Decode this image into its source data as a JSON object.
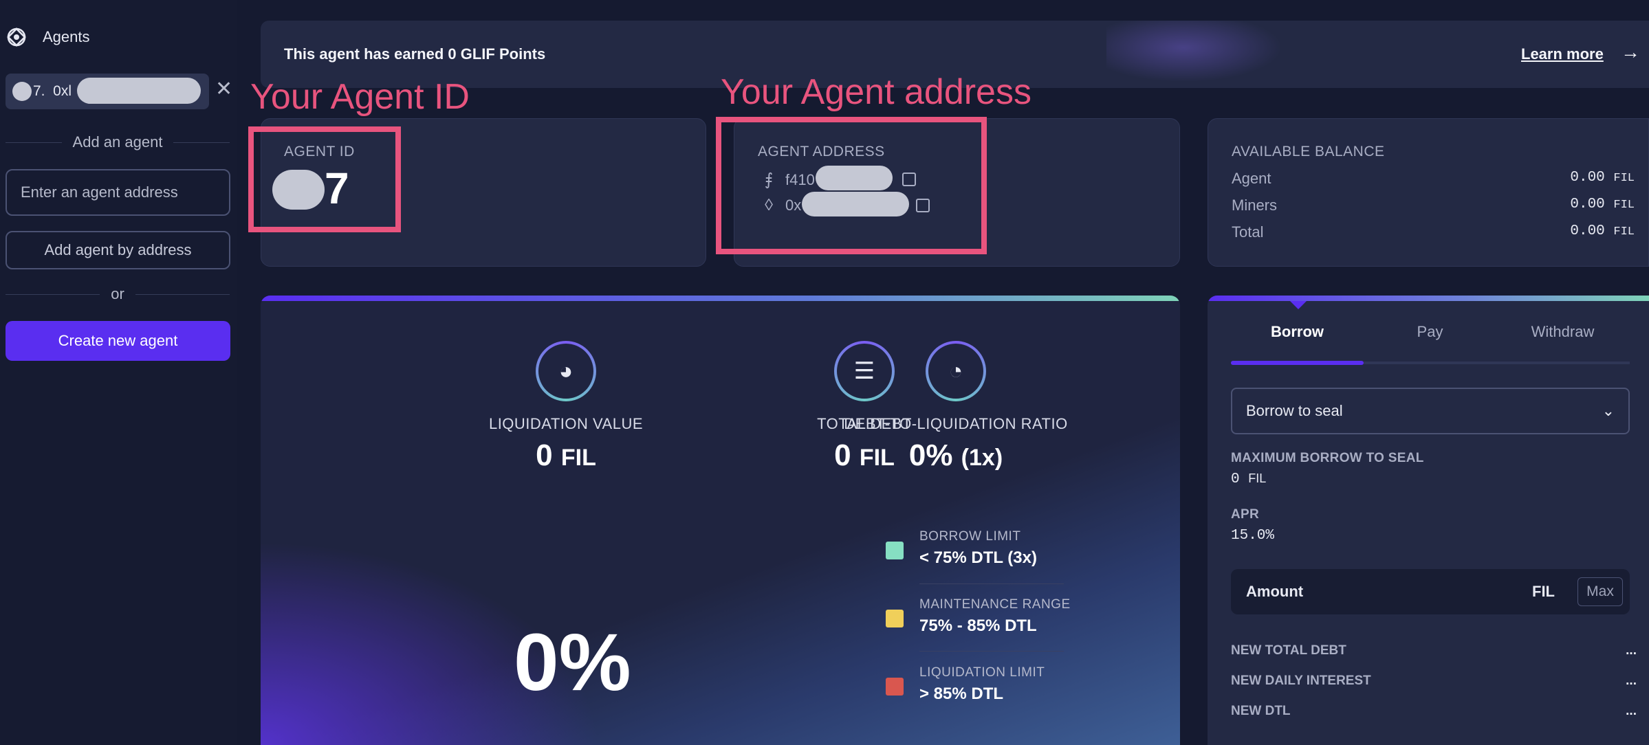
{
  "sidebar": {
    "title": "Agents",
    "agent_chip": {
      "prefix": "7.  0xl"
    },
    "add_agent_divider": "Add an agent",
    "address_placeholder": "Enter an agent address",
    "add_by_address_label": "Add agent by address",
    "or_divider": "or",
    "create_label": "Create new agent",
    "close_glyph": "✕"
  },
  "banner": {
    "message": "This agent has earned 0 GLIF Points",
    "learn_more": "Learn more",
    "arrow_glyph": "→"
  },
  "agent_id": {
    "label": "AGENT ID",
    "value": "7"
  },
  "agent_address": {
    "label": "AGENT ADDRESS",
    "filecoin_prefix": "f410",
    "filecoin_icon": "filecoin-icon",
    "eth_prefix": "0x",
    "eth_icon": "ethereum-icon"
  },
  "balance": {
    "label": "AVAILABLE BALANCE",
    "rows": [
      {
        "name": "Agent",
        "value": "0.00",
        "unit": "FIL"
      },
      {
        "name": "Miners",
        "value": "0.00",
        "unit": "FIL"
      },
      {
        "name": "Total",
        "value": "0.00",
        "unit": "FIL"
      }
    ]
  },
  "stats": {
    "liquidation": {
      "label": "LIQUIDATION VALUE",
      "value": "0",
      "unit": "FIL",
      "icon": "coins-icon"
    },
    "debt": {
      "label": "TOTAL DEBT",
      "value": "0",
      "unit": "FIL",
      "icon": "stack-icon"
    },
    "dtl": {
      "label": "DEBT-TO-LIQUIDATION RATIO",
      "value": "0%",
      "suffix": "(1x)",
      "icon": "gauge-icon"
    },
    "big_percent": "0%",
    "legend": [
      {
        "name": "BORROW LIMIT",
        "value": "< 75% DTL (3x)",
        "color": "#86dfc2"
      },
      {
        "name": "MAINTENANCE RANGE",
        "value": "75% - 85% DTL",
        "color": "#f0cf5a"
      },
      {
        "name": "LIQUIDATION LIMIT",
        "value": "> 85% DTL",
        "color": "#d9574f"
      }
    ]
  },
  "action": {
    "tabs": [
      "Borrow",
      "Pay",
      "Withdraw"
    ],
    "active_tab": "Borrow",
    "select_value": "Borrow to seal",
    "max_borrow_label": "MAXIMUM BORROW TO SEAL",
    "max_borrow_value": "0",
    "max_borrow_unit": "FIL",
    "apr_label": "APR",
    "apr_value": "15.0%",
    "amount_label": "Amount",
    "amount_unit": "FIL",
    "max_label": "Max",
    "summary": [
      {
        "name": "NEW TOTAL DEBT",
        "value": "..."
      },
      {
        "name": "NEW DAILY INTEREST",
        "value": "..."
      },
      {
        "name": "NEW DTL",
        "value": "..."
      }
    ]
  },
  "annotations": {
    "agent_id_text": "Your Agent ID",
    "agent_address_text": "Your Agent address",
    "color": "#e8547e"
  },
  "colors": {
    "accent": "#5a2ef0",
    "background": "#151a30",
    "card": "#232944"
  }
}
